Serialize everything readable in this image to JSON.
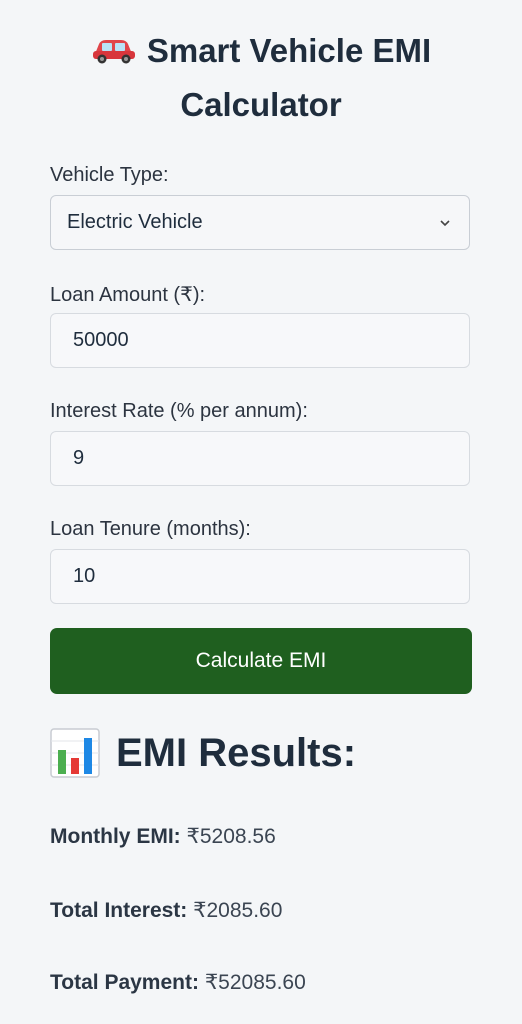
{
  "header": {
    "title_line1": "Smart Vehicle EMI",
    "title_line2": "Calculator"
  },
  "form": {
    "vehicle_type_label": "Vehicle Type:",
    "vehicle_type_value": "Electric Vehicle",
    "loan_amount_label": "Loan Amount (₹):",
    "loan_amount_value": "50000",
    "interest_rate_label": "Interest Rate (% per annum):",
    "interest_rate_value": "9",
    "tenure_label": "Loan Tenure (months):",
    "tenure_value": "10",
    "calculate_label": "Calculate EMI"
  },
  "results": {
    "heading": "EMI Results:",
    "monthly_emi_label": "Monthly EMI:",
    "monthly_emi_value": "₹5208.56",
    "total_interest_label": "Total Interest:",
    "total_interest_value": "₹2085.60",
    "total_payment_label": "Total Payment:",
    "total_payment_value": "₹52085.60"
  },
  "icons": {
    "title_icon": "car-icon",
    "results_icon": "bar-chart-icon",
    "select_icon": "chevron-down-icon"
  },
  "colors": {
    "accent_button": "#1f5f1f",
    "background": "#f4f6f8",
    "text": "#1f2d3d"
  }
}
